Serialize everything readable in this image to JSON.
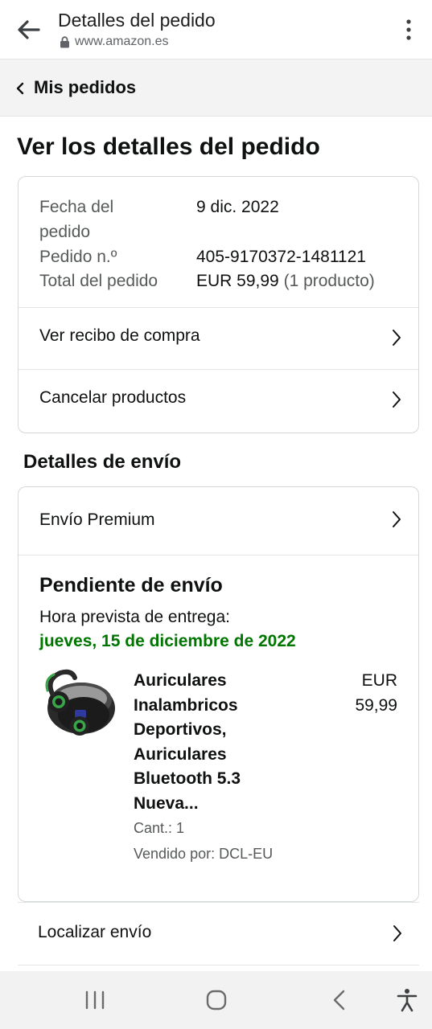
{
  "browser": {
    "title": "Detalles del pedido",
    "url": "www.amazon.es"
  },
  "breadcrumb": {
    "label": "Mis pedidos"
  },
  "page_title": "Ver los detalles del pedido",
  "order": {
    "date_label_line1": "Fecha del",
    "date_label_line2": "pedido",
    "date_value": "9 dic. 2022",
    "number_label": "Pedido n.º",
    "number_value": "405-9170372-1481121",
    "total_label": "Total del pedido",
    "total_value": "EUR 59,99",
    "total_items": "(1 producto)"
  },
  "actions": {
    "receipt": "Ver recibo de compra",
    "cancel": "Cancelar productos"
  },
  "shipping": {
    "section_title": "Detalles de envío",
    "method": "Envío Premium",
    "status": "Pendiente de envío",
    "eta_label": "Hora prevista de entrega:",
    "eta_date": "jueves, 15 de diciembre de 2022",
    "track": "Localizar envío"
  },
  "product": {
    "name_lines": [
      "Auriculares",
      "Inalambricos",
      "Deportivos,",
      "Auriculares",
      "Bluetooth 5.3",
      "Nueva..."
    ],
    "price_line1": "EUR",
    "price_line2": "59,99",
    "quantity": "Cant.: 1",
    "seller": "Vendido por: DCL-EU",
    "image_icon": "earbuds-product-image"
  },
  "colors": {
    "green": "#007600",
    "border": "#d5d9d9",
    "crumb_bg": "#f3f3f3"
  }
}
